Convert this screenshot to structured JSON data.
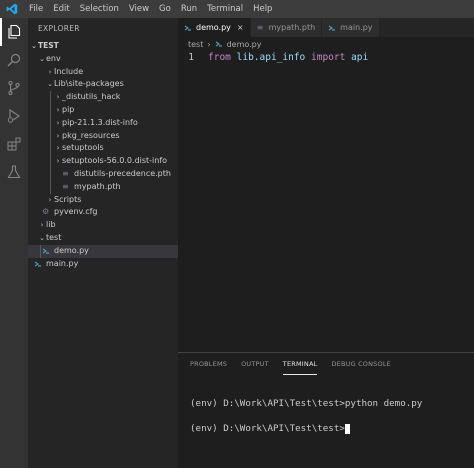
{
  "menu": [
    "File",
    "Edit",
    "Selection",
    "View",
    "Go",
    "Run",
    "Terminal",
    "Help"
  ],
  "sidebar": {
    "title": "EXPLORER",
    "root": "TEST",
    "items": [
      {
        "label": "env",
        "type": "folder"
      },
      {
        "label": "Include",
        "type": "folder"
      },
      {
        "label": "Lib\\site-packages",
        "type": "folder"
      },
      {
        "label": "_distutils_hack",
        "type": "folder"
      },
      {
        "label": "pip",
        "type": "folder"
      },
      {
        "label": "pip-21.1.3.dist-info",
        "type": "folder"
      },
      {
        "label": "pkg_resources",
        "type": "folder"
      },
      {
        "label": "setuptools",
        "type": "folder"
      },
      {
        "label": "setuptools-56.0.0.dist-info",
        "type": "folder"
      },
      {
        "label": "distutils-precedence.pth",
        "type": "file"
      },
      {
        "label": "mypath.pth",
        "type": "file"
      },
      {
        "label": "Scripts",
        "type": "folder"
      },
      {
        "label": "pyvenv.cfg",
        "type": "file"
      },
      {
        "label": "lib",
        "type": "folder"
      },
      {
        "label": "test",
        "type": "folder"
      },
      {
        "label": "demo.py",
        "type": "file"
      },
      {
        "label": "main.py",
        "type": "file"
      }
    ]
  },
  "tabs": [
    {
      "label": "demo.py",
      "active": true
    },
    {
      "label": "mypath.pth",
      "active": false
    },
    {
      "label": "main.py",
      "active": false
    }
  ],
  "breadcrumb": {
    "folder": "test",
    "file": "demo.py"
  },
  "code": {
    "line_number": "1",
    "kw_from": "from",
    "module": "lib.api_info",
    "kw_import": "import",
    "name": "api"
  },
  "panel": {
    "tabs": [
      "PROBLEMS",
      "OUTPUT",
      "TERMINAL",
      "DEBUG CONSOLE"
    ],
    "terminal_lines": [
      "(env) D:\\Work\\API\\Test\\test>python demo.py",
      "(env) D:\\Work\\API\\Test\\test>"
    ]
  },
  "colors": {
    "python_icon": "#519aba",
    "accent_vscode": "#23a9f2"
  }
}
